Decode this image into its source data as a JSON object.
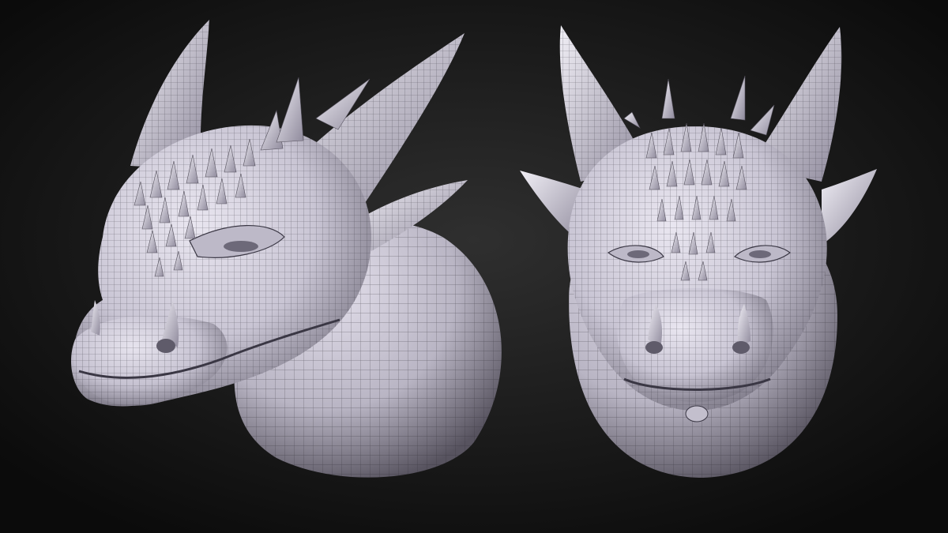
{
  "scene": {
    "background_color": "#0d0d0d",
    "background_glow_color": "#2f2f2f",
    "mesh_fill_color": "#d4d0de",
    "mesh_shadow_color": "#5c5866",
    "wire_color": "#2a2830",
    "subjects": [
      {
        "name": "dragon-head-three-quarter-view"
      },
      {
        "name": "dragon-head-front-view"
      }
    ]
  }
}
